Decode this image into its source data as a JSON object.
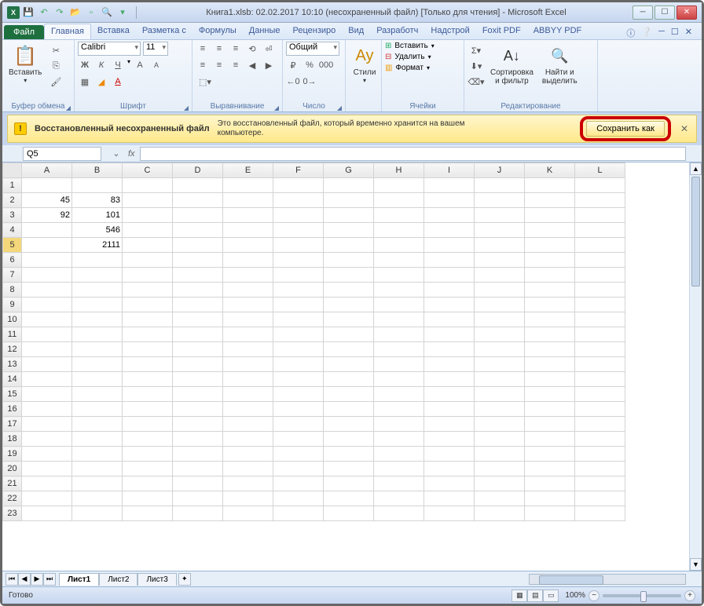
{
  "title": "Книга1.xlsb: 02.02.2017 10:10 (несохраненный файл)  [Только для чтения]  -  Microsoft Excel",
  "qat": {
    "dropdown": "▾"
  },
  "tabs": {
    "file": "Файл",
    "items": [
      "Главная",
      "Вставка",
      "Разметка с",
      "Формулы",
      "Данные",
      "Рецензиро",
      "Вид",
      "Разработч",
      "Надстрой",
      "Foxit PDF",
      "ABBYY PDF"
    ],
    "active": 0
  },
  "ribbon": {
    "clipboard": {
      "paste": "Вставить",
      "label": "Буфер обмена"
    },
    "font": {
      "name": "Calibri",
      "size": "11",
      "label": "Шрифт",
      "bold": "Ж",
      "italic": "К",
      "underline": "Ч"
    },
    "alignment": {
      "label": "Выравнивание"
    },
    "number": {
      "format": "Общий",
      "label": "Число"
    },
    "styles": {
      "btn": "Стили"
    },
    "cells": {
      "insert": "Вставить",
      "delete": "Удалить",
      "format": "Формат",
      "label": "Ячейки"
    },
    "editing": {
      "sort": "Сортировка\nи фильтр",
      "find": "Найти и\nвыделить",
      "label": "Редактирование"
    }
  },
  "message": {
    "title": "Восстановленный несохраненный файл",
    "text": "Это восстановленный файл, который временно хранится на вашем\nкомпьютере.",
    "button": "Сохранить как"
  },
  "name_box": "Q5",
  "fx": "fx",
  "columns": [
    "A",
    "B",
    "C",
    "D",
    "E",
    "F",
    "G",
    "H",
    "I",
    "J",
    "K",
    "L"
  ],
  "rows": [
    {
      "n": 1,
      "cells": [
        "",
        "",
        "",
        "",
        "",
        "",
        "",
        "",
        "",
        "",
        "",
        ""
      ]
    },
    {
      "n": 2,
      "cells": [
        "45",
        "83",
        "",
        "",
        "",
        "",
        "",
        "",
        "",
        "",
        "",
        ""
      ]
    },
    {
      "n": 3,
      "cells": [
        "92",
        "101",
        "",
        "",
        "",
        "",
        "",
        "",
        "",
        "",
        "",
        ""
      ]
    },
    {
      "n": 4,
      "cells": [
        "",
        "546",
        "",
        "",
        "",
        "",
        "",
        "",
        "",
        "",
        "",
        ""
      ]
    },
    {
      "n": 5,
      "cells": [
        "",
        "2111",
        "",
        "",
        "",
        "",
        "",
        "",
        "",
        "",
        "",
        ""
      ],
      "selected": true
    },
    {
      "n": 6,
      "cells": [
        "",
        "",
        "",
        "",
        "",
        "",
        "",
        "",
        "",
        "",
        "",
        ""
      ]
    },
    {
      "n": 7,
      "cells": [
        "",
        "",
        "",
        "",
        "",
        "",
        "",
        "",
        "",
        "",
        "",
        ""
      ]
    },
    {
      "n": 8,
      "cells": [
        "",
        "",
        "",
        "",
        "",
        "",
        "",
        "",
        "",
        "",
        "",
        ""
      ]
    },
    {
      "n": 9,
      "cells": [
        "",
        "",
        "",
        "",
        "",
        "",
        "",
        "",
        "",
        "",
        "",
        ""
      ]
    },
    {
      "n": 10,
      "cells": [
        "",
        "",
        "",
        "",
        "",
        "",
        "",
        "",
        "",
        "",
        "",
        ""
      ]
    },
    {
      "n": 11,
      "cells": [
        "",
        "",
        "",
        "",
        "",
        "",
        "",
        "",
        "",
        "",
        "",
        ""
      ]
    },
    {
      "n": 12,
      "cells": [
        "",
        "",
        "",
        "",
        "",
        "",
        "",
        "",
        "",
        "",
        "",
        ""
      ]
    },
    {
      "n": 13,
      "cells": [
        "",
        "",
        "",
        "",
        "",
        "",
        "",
        "",
        "",
        "",
        "",
        ""
      ]
    },
    {
      "n": 14,
      "cells": [
        "",
        "",
        "",
        "",
        "",
        "",
        "",
        "",
        "",
        "",
        "",
        ""
      ]
    },
    {
      "n": 15,
      "cells": [
        "",
        "",
        "",
        "",
        "",
        "",
        "",
        "",
        "",
        "",
        "",
        ""
      ]
    },
    {
      "n": 16,
      "cells": [
        "",
        "",
        "",
        "",
        "",
        "",
        "",
        "",
        "",
        "",
        "",
        ""
      ]
    },
    {
      "n": 17,
      "cells": [
        "",
        "",
        "",
        "",
        "",
        "",
        "",
        "",
        "",
        "",
        "",
        ""
      ]
    },
    {
      "n": 18,
      "cells": [
        "",
        "",
        "",
        "",
        "",
        "",
        "",
        "",
        "",
        "",
        "",
        ""
      ]
    },
    {
      "n": 19,
      "cells": [
        "",
        "",
        "",
        "",
        "",
        "",
        "",
        "",
        "",
        "",
        "",
        ""
      ]
    },
    {
      "n": 20,
      "cells": [
        "",
        "",
        "",
        "",
        "",
        "",
        "",
        "",
        "",
        "",
        "",
        ""
      ]
    },
    {
      "n": 21,
      "cells": [
        "",
        "",
        "",
        "",
        "",
        "",
        "",
        "",
        "",
        "",
        "",
        ""
      ]
    },
    {
      "n": 22,
      "cells": [
        "",
        "",
        "",
        "",
        "",
        "",
        "",
        "",
        "",
        "",
        "",
        ""
      ]
    },
    {
      "n": 23,
      "cells": [
        "",
        "",
        "",
        "",
        "",
        "",
        "",
        "",
        "",
        "",
        "",
        ""
      ]
    }
  ],
  "sheets": [
    "Лист1",
    "Лист2",
    "Лист3"
  ],
  "active_sheet": 0,
  "status": {
    "ready": "Готово",
    "zoom": "100%"
  }
}
